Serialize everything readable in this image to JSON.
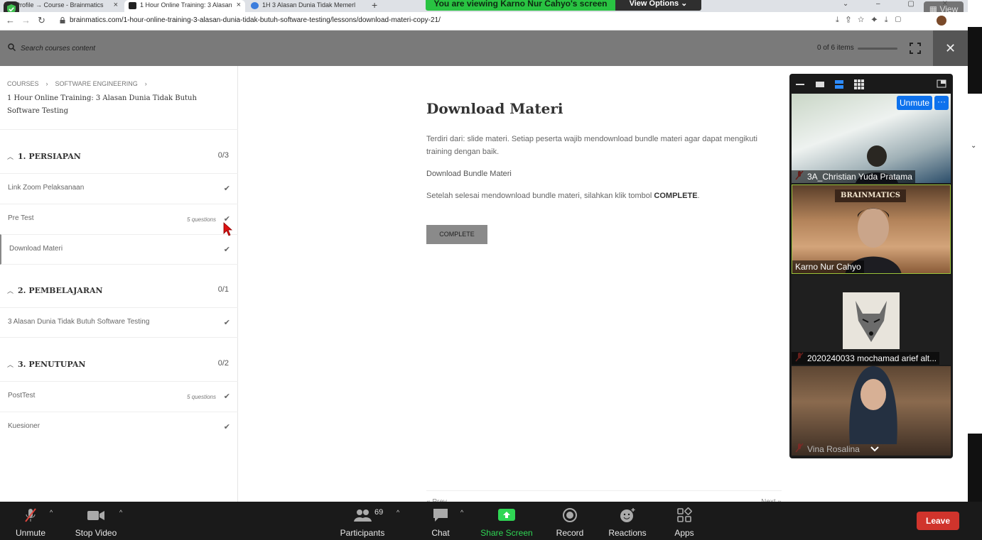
{
  "browser": {
    "tabs": [
      {
        "label": "Profile → Course - Brainmatics"
      },
      {
        "label": "1 Hour Online Training: 3 Alasan"
      },
      {
        "label": "1H 3 Alasan Dunia Tidak Memerl"
      }
    ],
    "url": "brainmatics.com/1-hour-online-training-3-alasan-dunia-tidak-butuh-software-testing/lessons/download-materi-copy-21/",
    "share_banner": "You are viewing Karno Nur Cahyo's screen",
    "view_options_label": "View Options",
    "view_button_label": "View"
  },
  "course_header": {
    "search_placeholder": "Search courses content",
    "items_count": "0 of 6 items",
    "progress_fraction": 0
  },
  "sidebar": {
    "breadcrumb": [
      "COURSES",
      "SOFTWARE ENGINEERING"
    ],
    "course_title": "1 Hour Online Training: 3 Alasan Dunia Tidak Butuh Software Testing",
    "sections": [
      {
        "title": "1. PERSIAPAN",
        "count": "0/3",
        "lessons": [
          {
            "name": "Link Zoom Pelaksanaan",
            "meta": ""
          },
          {
            "name": "Pre Test",
            "meta": "5 questions"
          },
          {
            "name": "Download Materi",
            "meta": ""
          }
        ]
      },
      {
        "title": "2. PEMBELAJARAN",
        "count": "0/1",
        "lessons": [
          {
            "name": "3 Alasan Dunia Tidak Butuh Software Testing",
            "meta": ""
          }
        ]
      },
      {
        "title": "3. PENUTUPAN",
        "count": "0/2",
        "lessons": [
          {
            "name": "PostTest",
            "meta": "5 questions"
          },
          {
            "name": "Kuesioner",
            "meta": ""
          }
        ]
      }
    ]
  },
  "lesson": {
    "title": "Download Materi",
    "description": "Terdiri dari: slide materi. Setiap peserta wajib mendownload bundle materi agar dapat mengikuti training dengan baik.",
    "download_link": "Download Bundle Materi",
    "after_text": "Setelah selesai mendownload bundle materi, silahkan klik tombol",
    "after_text_bold": "COMPLETE",
    "after_text_end": ".",
    "complete_button": "COMPLETE",
    "prev_label": "« Prev",
    "next_label": "Next »"
  },
  "zoom_panel": {
    "unmute_label": "Unmute",
    "more_label": "···",
    "participants": [
      {
        "name": "3A_Christian Yuda Pratama",
        "muted": true
      },
      {
        "name": "Karno Nur Cahyo",
        "muted": false
      },
      {
        "name": "2020240033 mochamad arief alt...",
        "muted": true
      },
      {
        "name": "Vina Rosalina",
        "muted": true
      }
    ],
    "logo_text": "BRAINMATICS"
  },
  "zoom_bar": {
    "unmute": "Unmute",
    "stop_video": "Stop Video",
    "participants": "Participants",
    "participants_count": "69",
    "chat": "Chat",
    "share_screen": "Share Screen",
    "record": "Record",
    "reactions": "Reactions",
    "apps": "Apps",
    "leave": "Leave"
  },
  "colors": {
    "share_green": "#29c342",
    "zoom_blue": "#0e72ed",
    "leave_red": "#d0342c",
    "header_gray": "#7a7a7a"
  }
}
